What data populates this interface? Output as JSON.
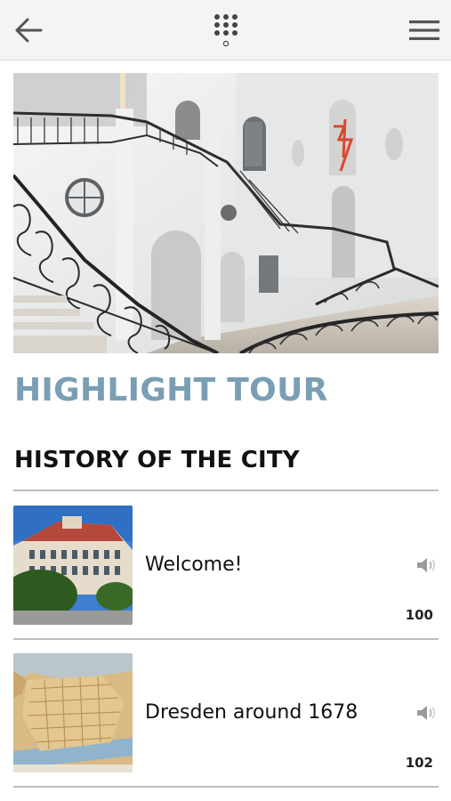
{
  "topbar": {
    "back_icon": "arrow-left-icon",
    "keypad_icon": "keypad-icon",
    "menu_icon": "hamburger-menu-icon"
  },
  "hero": {
    "image": "palace-staircase-photo"
  },
  "tour": {
    "title": "HIGHLIGHT TOUR"
  },
  "section": {
    "title": "HISTORY OF THE CITY"
  },
  "items": [
    {
      "title": "Welcome!",
      "number": "100",
      "thumbnail": "baroque-building-photo",
      "icon": "speaker-icon"
    },
    {
      "title": "Dresden around 1678",
      "number": "102",
      "thumbnail": "city-model-photo",
      "icon": "speaker-icon"
    }
  ],
  "colors": {
    "accent": "#7a9fb4",
    "topbar": "#f4f4f4",
    "divider": "#bdbdbd",
    "icon": "#555555"
  }
}
